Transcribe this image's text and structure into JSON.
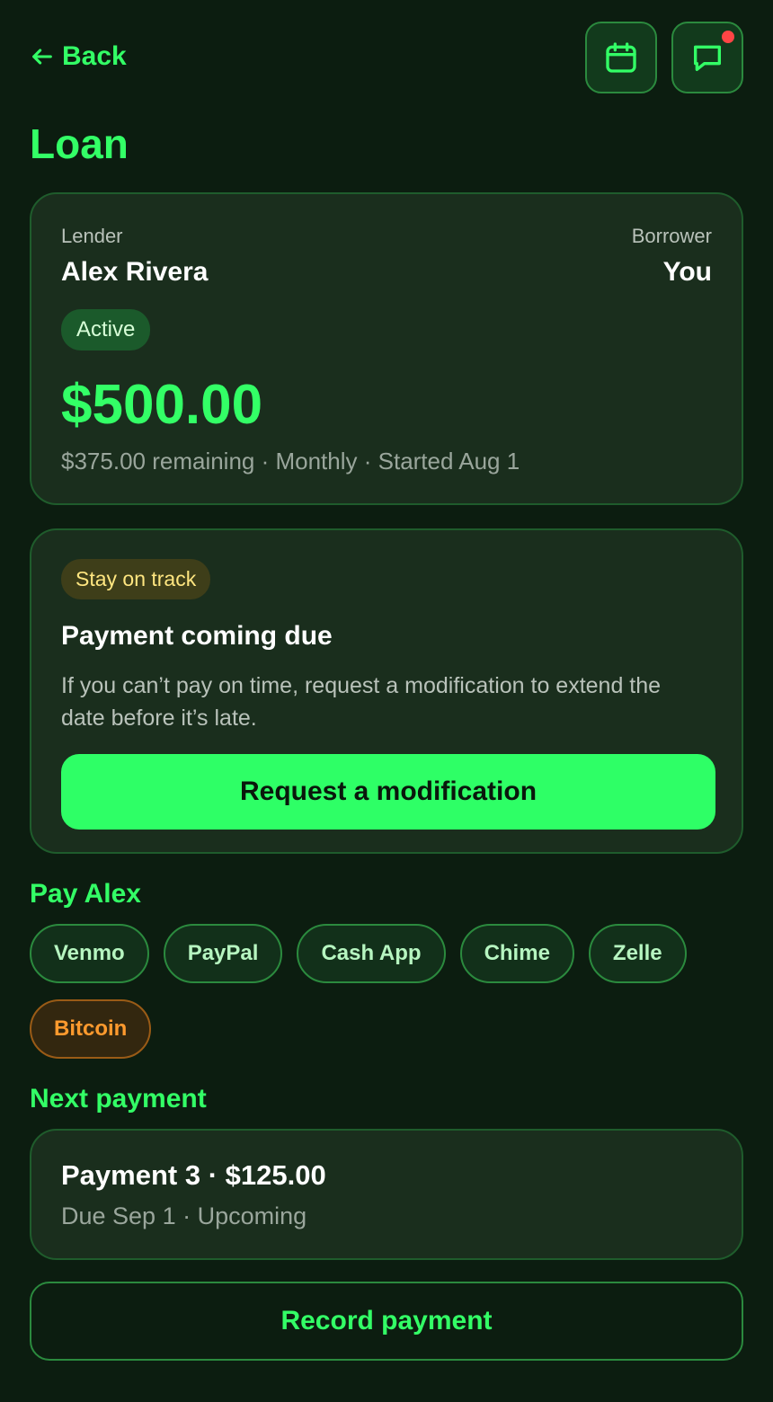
{
  "header": {
    "back_label": "Back",
    "title": "Loan"
  },
  "loan": {
    "lender_label": "Lender",
    "lender_name": "Alex Rivera",
    "borrower_label": "Borrower",
    "borrower_name": "You",
    "status": "Active",
    "amount": "$500.00",
    "meta": "$375.00 remaining · Monthly · Started Aug 1"
  },
  "reminder": {
    "badge": "Stay on track",
    "title": "Payment coming due",
    "text": "If you can’t pay on time, request a modification to extend the date before it’s late.",
    "button": "Request a modification"
  },
  "pay": {
    "title": "Pay Alex",
    "methods": [
      "Venmo",
      "PayPal",
      "Cash App",
      "Chime",
      "Zelle",
      "Bitcoin"
    ]
  },
  "next_payment": {
    "title": "Next payment",
    "main": "Payment 3 · $125.00",
    "sub": "Due Sep 1 · Upcoming"
  },
  "record_button": "Record payment",
  "colors": {
    "background": "#0c1d10",
    "accent": "#33ff66",
    "card": "#1a2e1d",
    "notification": "#ff4545",
    "warning": "#ffe680",
    "bitcoin": "#ff9a2e"
  },
  "icons": {
    "back": "arrow-left-icon",
    "calendar": "calendar-icon",
    "messages": "chat-bubble-icon"
  }
}
